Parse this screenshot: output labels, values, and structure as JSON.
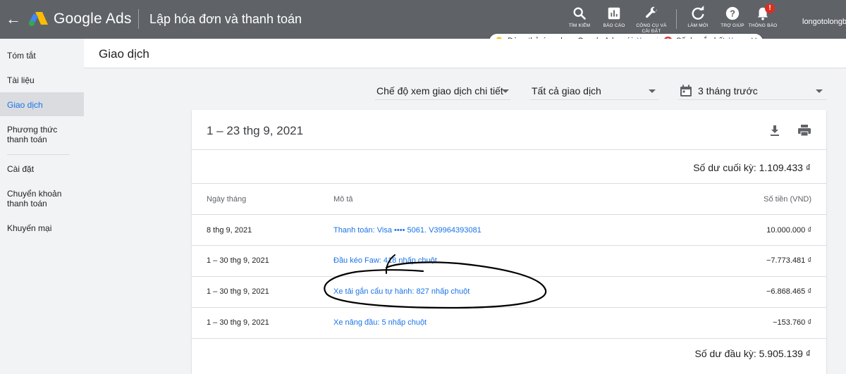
{
  "topbar": {
    "brand": "Google Ads",
    "page_title": "Lập hóa đơn và thanh toán",
    "account": "longotolongb",
    "tools": [
      {
        "icon": "search-icon",
        "label": "TÌM KIẾM"
      },
      {
        "icon": "reports-icon",
        "label": "BÁO CÁO"
      },
      {
        "icon": "wrench-icon",
        "label": "CÔNG CỤ VÀ CÀI ĐẶT"
      },
      {
        "icon": "refresh-icon",
        "label": "LÀM MỚI"
      },
      {
        "icon": "help-icon",
        "label": "TRỢ GIÚP"
      },
      {
        "icon": "bell-icon",
        "label": "THÔNG BÁO"
      }
    ],
    "notification_badge": "!"
  },
  "alert": {
    "try_app_text": "Dùng thử ứng dụng Google Ads mới",
    "try_app_link": "Xem",
    "balance_text": "Số dư sắp hết",
    "balance_link": "Xem",
    "close": "✕"
  },
  "sidebar": {
    "items": [
      {
        "label": "Tóm tắt"
      },
      {
        "label": "Tài liệu"
      },
      {
        "label": "Giao dịch"
      },
      {
        "label": "Phương thức\nthanh toán"
      },
      {
        "label": "Cài đặt"
      },
      {
        "label": "Chuyển khoản\nthanh toán"
      },
      {
        "label": "Khuyến mại"
      }
    ]
  },
  "header": {
    "title": "Giao dịch"
  },
  "filters": {
    "view_mode": "Chế độ xem giao dịch chi tiết",
    "type": "Tất cả giao dịch",
    "range": "3 tháng trước"
  },
  "card": {
    "period": "1 – 23 thg 9, 2021",
    "closing_balance": "Số dư cuối kỳ: 1.109.433 ₫",
    "columns": {
      "date": "Ngày tháng",
      "desc": "Mô tả",
      "amount": "Số tiền (VND)"
    },
    "rows": [
      {
        "date": "8 thg 9, 2021",
        "desc": "Thanh toán: Visa •••• 5061. V39964393081",
        "amount": "10.000.000 ₫"
      },
      {
        "date": "1 – 30 thg 9, 2021",
        "desc": "Đầu kéo Faw: 418 nhấp chuột",
        "amount": "−7.773.481 ₫"
      },
      {
        "date": "1 – 30 thg 9, 2021",
        "desc": "Xe tải gắn cẩu tự hành: 827 nhấp chuột",
        "amount": "−6.868.465 ₫"
      },
      {
        "date": "1 – 30 thg 9, 2021",
        "desc": "Xe nâng đầu: 5 nhấp chuột",
        "amount": "−153.760 ₫"
      }
    ],
    "opening_balance": "Số dư đầu kỳ: 5.905.139 ₫"
  },
  "colors": {
    "topbar": "#5f6368",
    "link": "#1a73e8",
    "error": "#d93025",
    "active_nav_bg": "#dadce0"
  }
}
